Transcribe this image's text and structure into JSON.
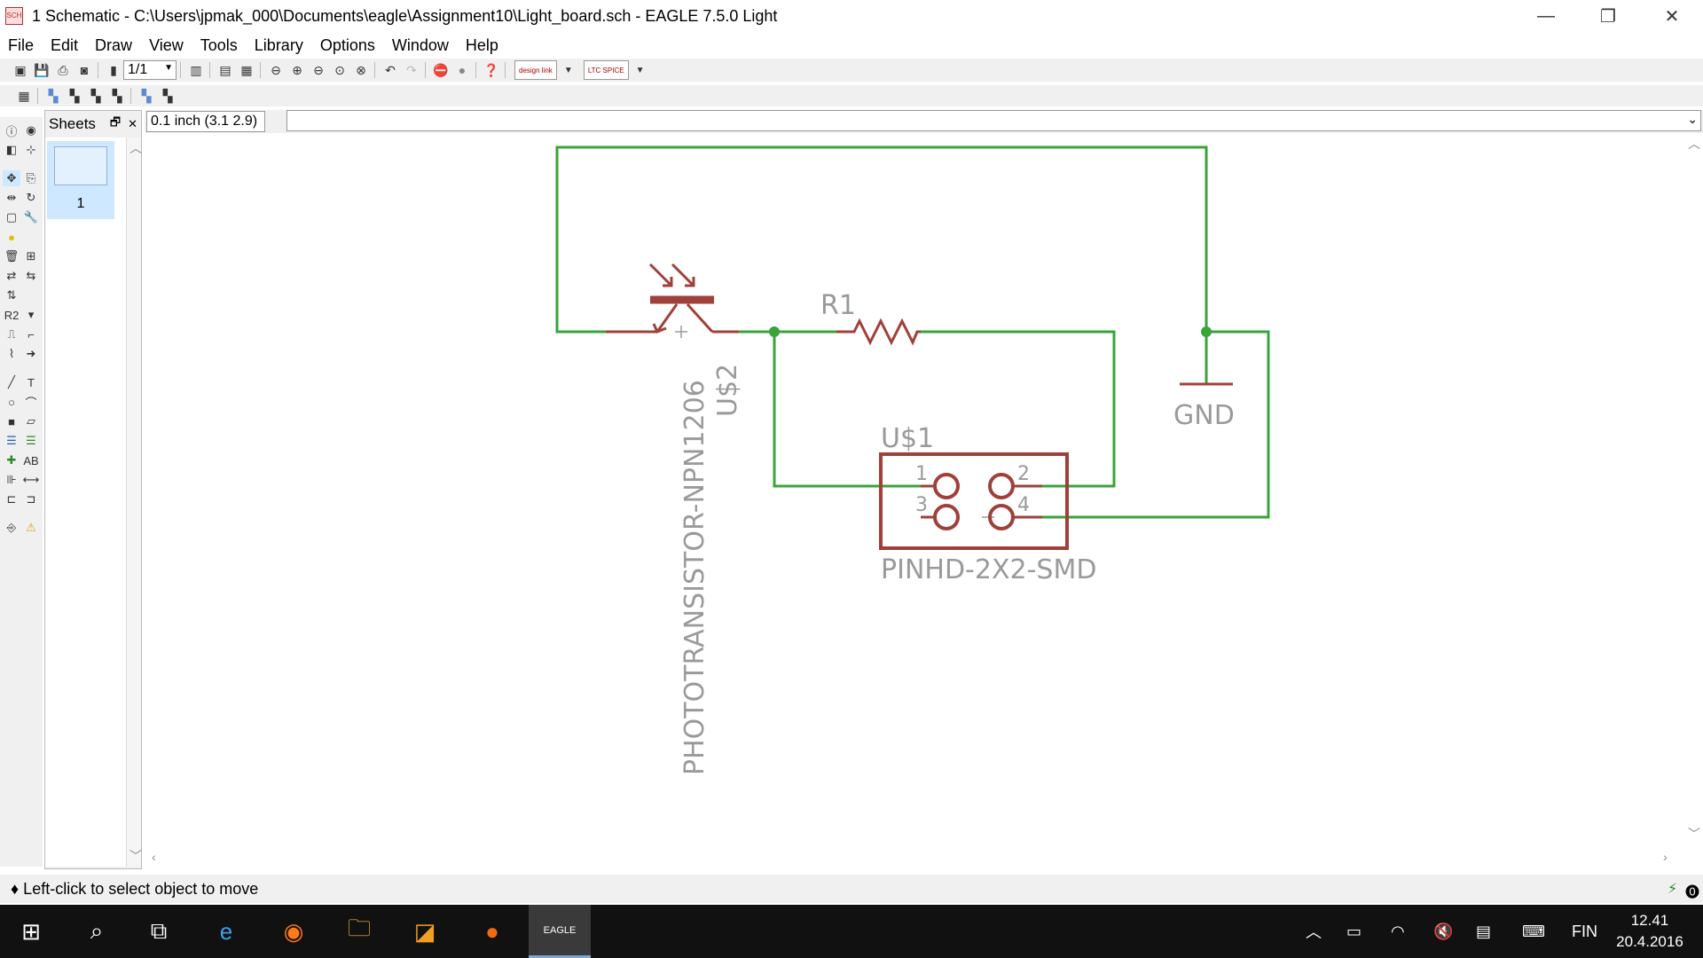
{
  "window": {
    "title": "1 Schematic - C:\\Users\\jpmak_000\\Documents\\eagle\\Assignment10\\Light_board.sch - EAGLE 7.5.0 Light",
    "minimize": "—",
    "restore": "❐",
    "close": "✕"
  },
  "menu": [
    "File",
    "Edit",
    "Draw",
    "View",
    "Tools",
    "Library",
    "Options",
    "Window",
    "Help"
  ],
  "toolbar": {
    "sheet_select": "1/1",
    "designlink_label": "design link",
    "ltspice_label": "LTC SPICE"
  },
  "sheets_panel": {
    "title": "Sheets",
    "float_icon": "🗗",
    "close_icon": "✕",
    "sheet_number": "1"
  },
  "coord_readout": "0.1 inch (3.1 2.9)",
  "schematic": {
    "labels": {
      "r1": "R1",
      "gnd": "GND",
      "u1": "U$1",
      "u1_value": "PINHD-2X2-SMD",
      "u2": "U$2",
      "u2_value": "PHOTOTRANSISTOR-NPN1206",
      "pin1": "1",
      "pin2": "2",
      "pin3": "3",
      "pin4": "4"
    },
    "colors": {
      "wire": "#3aa33a",
      "symbol": "#a0403a",
      "text": "#9a9a9a",
      "junction": "#3aa33a"
    }
  },
  "status": "♦ Left-click to select object to move",
  "taskbar": {
    "language": "FIN",
    "time": "12.41",
    "date": "20.4.2016",
    "eagle_label": "EAGLE"
  }
}
